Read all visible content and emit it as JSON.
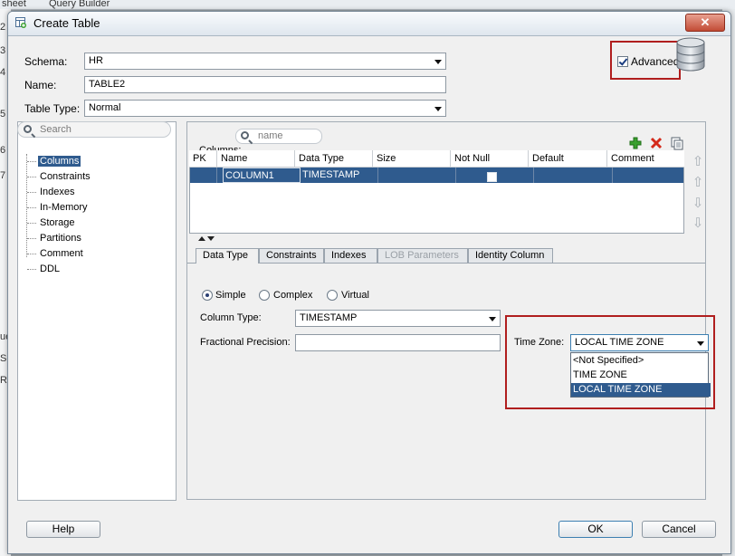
{
  "background": {
    "tabs": [
      "sheet",
      "Query Builder"
    ],
    "left_fragments": [
      "2",
      "3",
      "4",
      "5",
      "6",
      "7",
      "ue",
      "SQ",
      "RA"
    ]
  },
  "window": {
    "title": "Create Table",
    "close_glyph": "✕"
  },
  "form": {
    "schema_label": "Schema:",
    "schema_value": "HR",
    "name_label": "Name:",
    "name_value": "TABLE2",
    "table_type_label": "Table Type:",
    "table_type_value": "Normal",
    "advanced_label": "Advanced",
    "advanced_checked": true
  },
  "nav": {
    "search_placeholder": "Search",
    "items": [
      "Columns",
      "Constraints",
      "Indexes",
      "In-Memory",
      "Storage",
      "Partitions",
      "Comment",
      "DDL"
    ],
    "selected": "Columns"
  },
  "columns": {
    "label": "Columns:",
    "search_placeholder": "name",
    "headers": [
      "PK",
      "Name",
      "Data Type",
      "Size",
      "Not Null",
      "Default",
      "Comment"
    ],
    "rows": [
      {
        "pk": "",
        "name": "COLUMN1",
        "data_type": "TIMESTAMP",
        "size": "",
        "not_null": false,
        "default": "",
        "comment": ""
      }
    ]
  },
  "tabs": {
    "items": [
      "Data Type",
      "Constraints",
      "Indexes",
      "LOB Parameters",
      "Identity Column"
    ],
    "active": "Data Type",
    "disabled": [
      "LOB Parameters"
    ]
  },
  "data_type": {
    "radio_simple": "Simple",
    "radio_complex": "Complex",
    "radio_virtual": "Virtual",
    "selected_radio": "Simple",
    "column_type_label": "Column Type:",
    "column_type_value": "TIMESTAMP",
    "fractional_precision_label": "Fractional Precision:",
    "fractional_precision_value": "",
    "time_zone_label": "Time Zone:",
    "time_zone_value": "LOCAL TIME ZONE",
    "time_zone_options": [
      "<Not Specified>",
      "TIME ZONE",
      "LOCAL TIME ZONE"
    ],
    "time_zone_selected": "LOCAL TIME ZONE"
  },
  "buttons": {
    "help": "Help",
    "ok": "OK",
    "cancel": "Cancel"
  },
  "colors": {
    "selection": "#2f5b8e",
    "highlight_border": "#b01e1e",
    "add_icon": "#3aa02f",
    "delete_icon": "#d42a1a"
  },
  "icons": [
    "create-table-icon",
    "database-icon",
    "search-icon",
    "add-column-icon",
    "delete-column-icon",
    "copy-column-icon",
    "move-top-icon",
    "move-up-icon",
    "move-down-icon",
    "move-bottom-icon",
    "collapse-arrow-icon",
    "expand-arrow-icon"
  ]
}
